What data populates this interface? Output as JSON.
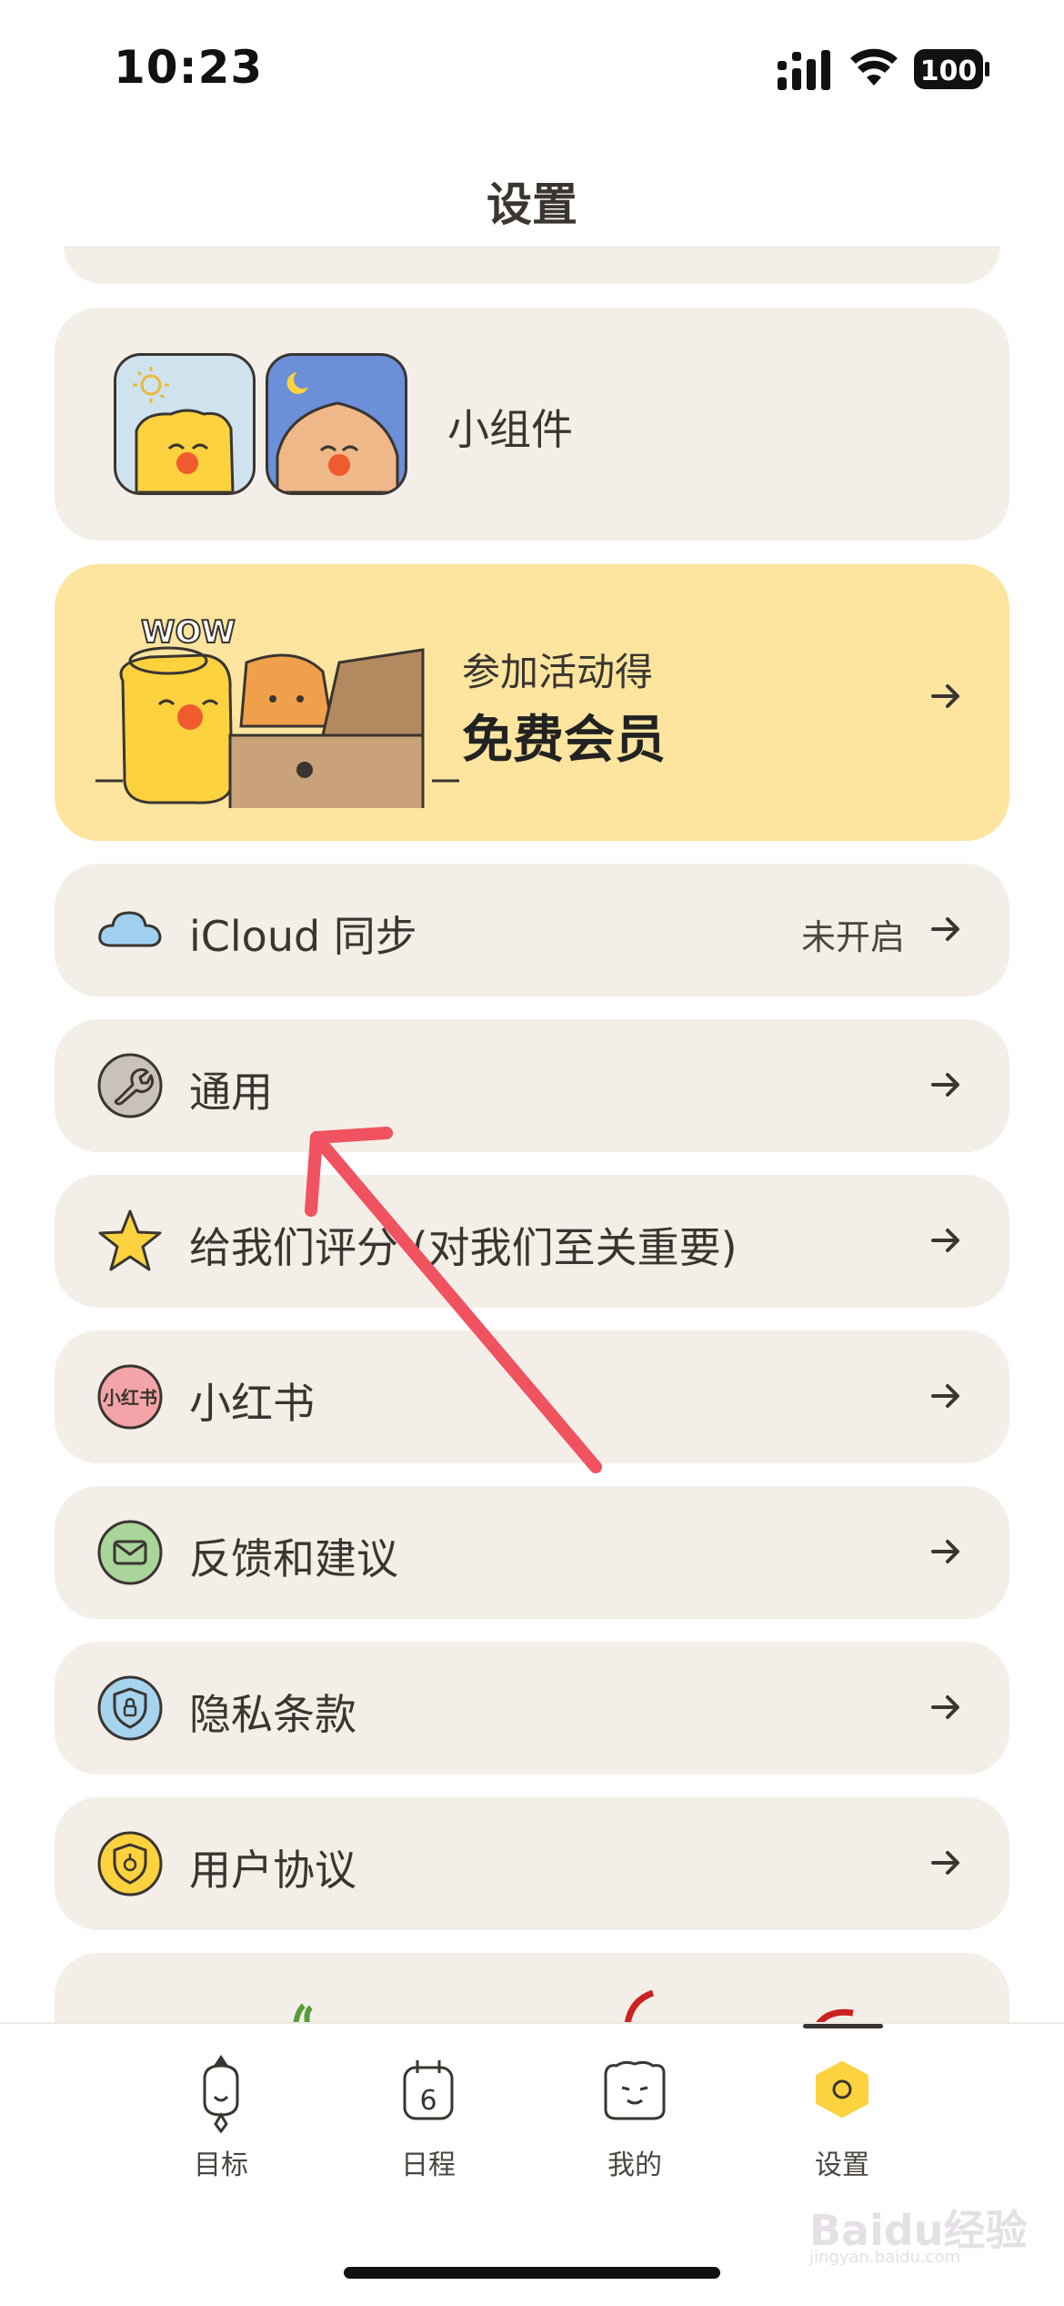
{
  "status": {
    "time": "10:23",
    "battery": "100"
  },
  "nav": {
    "title": "设置"
  },
  "widget": {
    "label": "小组件"
  },
  "promo": {
    "subtitle": "参加活动得",
    "title": "免费会员",
    "art_text": "WOW"
  },
  "rows": [
    {
      "label": "iCloud 同步",
      "value": "未开启",
      "icon": "cloud-icon"
    },
    {
      "label": "通用",
      "icon": "wrench-icon"
    },
    {
      "label": "给我们评分 (对我们至关重要)",
      "icon": "star-icon"
    },
    {
      "label": "小红书",
      "icon": "xiaohongshu-icon",
      "icon_text": "小红书"
    },
    {
      "label": "反馈和建议",
      "icon": "mail-icon"
    },
    {
      "label": "隐私条款",
      "icon": "privacy-shield-icon"
    },
    {
      "label": "用户协议",
      "icon": "agreement-shield-icon"
    }
  ],
  "tabs": [
    {
      "label": "目标",
      "icon": "goal-icon"
    },
    {
      "label": "日程",
      "icon": "calendar-icon",
      "icon_text": "6"
    },
    {
      "label": "我的",
      "icon": "face-icon"
    },
    {
      "label": "设置",
      "icon": "settings-icon",
      "selected": true
    }
  ],
  "watermark": {
    "text": "Baidu经验",
    "sub": "jingyan.baidu.com"
  },
  "colors": {
    "card": "#f3efe8",
    "promo": "#fde59f",
    "arrow_annotation": "#f0525f",
    "text": "#3a3530"
  }
}
